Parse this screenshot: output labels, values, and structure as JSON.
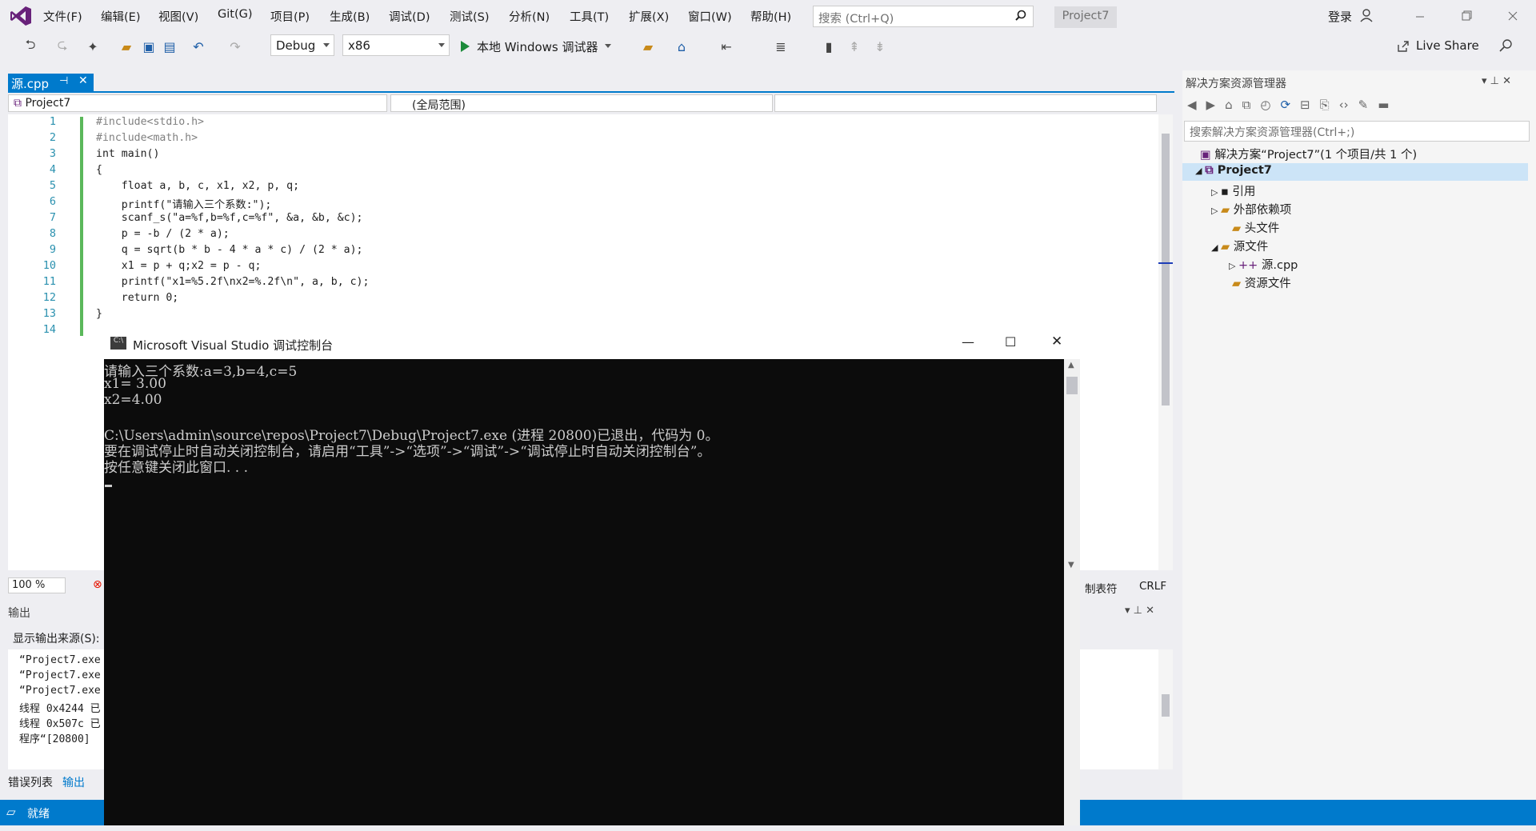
{
  "menubar": {
    "items": [
      "文件(F)",
      "编辑(E)",
      "视图(V)",
      "Git(G)",
      "项目(P)",
      "生成(B)",
      "调试(D)",
      "测试(S)",
      "分析(N)",
      "工具(T)",
      "扩展(X)",
      "窗口(W)",
      "帮助(H)"
    ],
    "search_placeholder": "搜索 (Ctrl+Q)",
    "project_name": "Project7",
    "login": "登录"
  },
  "toolbar": {
    "config": "Debug",
    "platform": "x86",
    "run_label": "本地 Windows 调试器",
    "live_share": "Live Share"
  },
  "editor": {
    "tab_title": "源.cpp",
    "nav_project": "Project7",
    "nav_scope": "(全局范围)",
    "line_numbers": [
      "1",
      "2",
      "3",
      "4",
      "5",
      "6",
      "7",
      "8",
      "9",
      "10",
      "11",
      "12",
      "13",
      "14"
    ],
    "lines": [
      "#include<stdio.h>",
      "#include<math.h>",
      "int main()",
      "{",
      "    float a, b, c, x1, x2, p, q;",
      "    printf(\"请输入三个系数:\");",
      "    scanf_s(\"a=%f,b=%f,c=%f\", &a, &b, &c);",
      "    p = -b / (2 * a);",
      "    q = sqrt(b * b - 4 * a * c) / (2 * a);",
      "    x1 = p + q;x2 = p - q;",
      "    printf(\"x1=%5.2f\\nx2=%.2f\\n\", a, b, c);",
      "    return 0;",
      "}",
      ""
    ],
    "zoom": "100 %",
    "tab_mode": "制表符",
    "line_ending": "CRLF"
  },
  "output": {
    "title": "输出",
    "source_label": "显示输出来源(S):",
    "lines": [
      "“Project7.exe",
      "“Project7.exe",
      "“Project7.exe",
      "线程 0x4244 已",
      "线程 0x507c 已",
      "程序“[20800]"
    ],
    "tab_errors": "错误列表",
    "tab_output": "输出"
  },
  "status": {
    "text": "就绪"
  },
  "solution_explorer": {
    "title": "解决方案资源管理器",
    "search_placeholder": "搜索解决方案资源管理器(Ctrl+;)",
    "solution": "解决方案“Project7”(1 个项目/共 1 个)",
    "project": "Project7",
    "items": [
      "引用",
      "外部依赖项",
      "头文件",
      "源文件",
      "源.cpp",
      "资源文件"
    ]
  },
  "console": {
    "title": "Microsoft Visual Studio 调试控制台",
    "lines": [
      "请输入三个系数:a=3,b=4,c=5",
      "x1= 3.00",
      "x2=4.00",
      "",
      "C:\\Users\\admin\\source\\repos\\Project7\\Debug\\Project7.exe (进程 20800)已退出，代码为 0。",
      "要在调试停止时自动关闭控制台，请启用“工具”->“选项”->“调试”->“调试停止时自动关闭控制台”。",
      "按任意键关闭此窗口. . ."
    ]
  },
  "colors": {
    "accent": "#007acc",
    "console_bg": "#0c0c0c",
    "keyword": "#0000ff",
    "string": "#a31515"
  }
}
